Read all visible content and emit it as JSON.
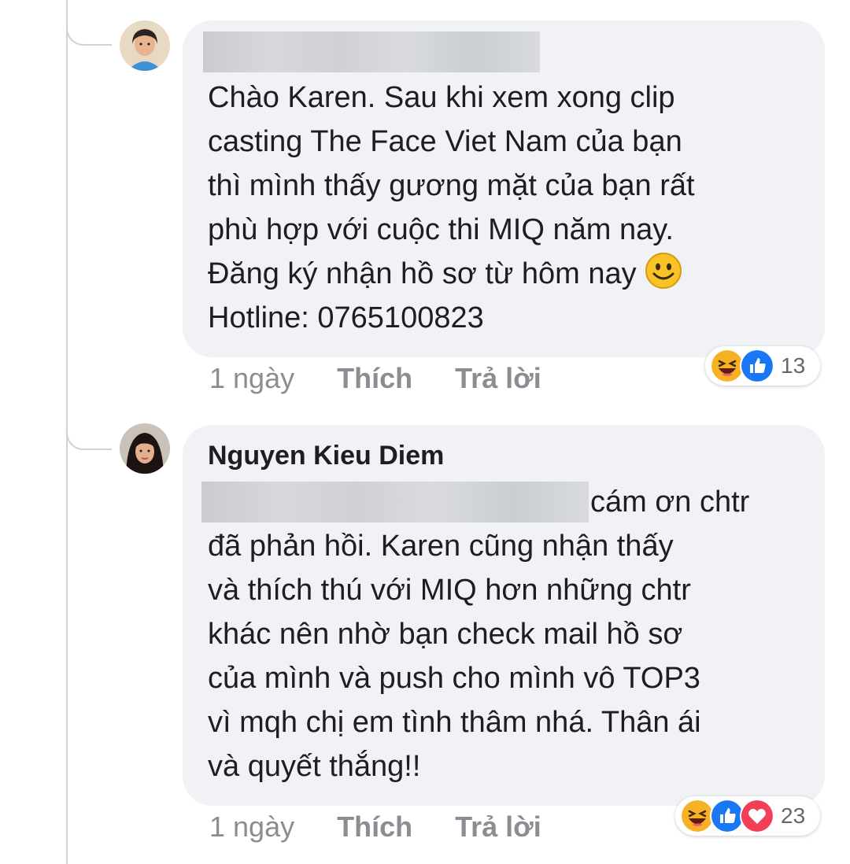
{
  "comments": [
    {
      "author": "",
      "text": "Chào Karen. Sau khi xem xong clip\ncasting The Face Viet Nam của bạn\nthì mình thấy gương mặt của bạn rất\nphù hợp với cuộc thi MIQ năm nay.\nĐăng ký nhận hồ sơ từ hôm nay ",
      "text_after": "Hotline: 0765100823",
      "time": "1 ngày",
      "like_label": "Thích",
      "reply_label": "Trả lời",
      "reaction_count": "13",
      "reactions": [
        "haha-icon",
        "like-icon"
      ]
    },
    {
      "author": "Nguyen Kieu Diem",
      "text_first_line": "cám ơn chtr",
      "text": "đã phản hồi. Karen cũng nhận thấy\nvà thích thú với MIQ hơn những chtr\nkhác nên nhờ bạn check mail hồ sơ\ncủa mình và push cho mình vô TOP3\nvì mqh chị em tình thâm nhá. Thân ái\nvà quyết thắng!!",
      "time": "1 ngày",
      "like_label": "Thích",
      "reply_label": "Trả lời",
      "reaction_count": "23",
      "reactions": [
        "haha-icon",
        "like-icon",
        "love-icon"
      ]
    }
  ],
  "colors": {
    "bubble": "#f0f2f5",
    "meta_text": "#8a8d91",
    "like_blue": "#1877f2",
    "love_red": "#f33e58",
    "haha_yellow": "#f7b125"
  }
}
